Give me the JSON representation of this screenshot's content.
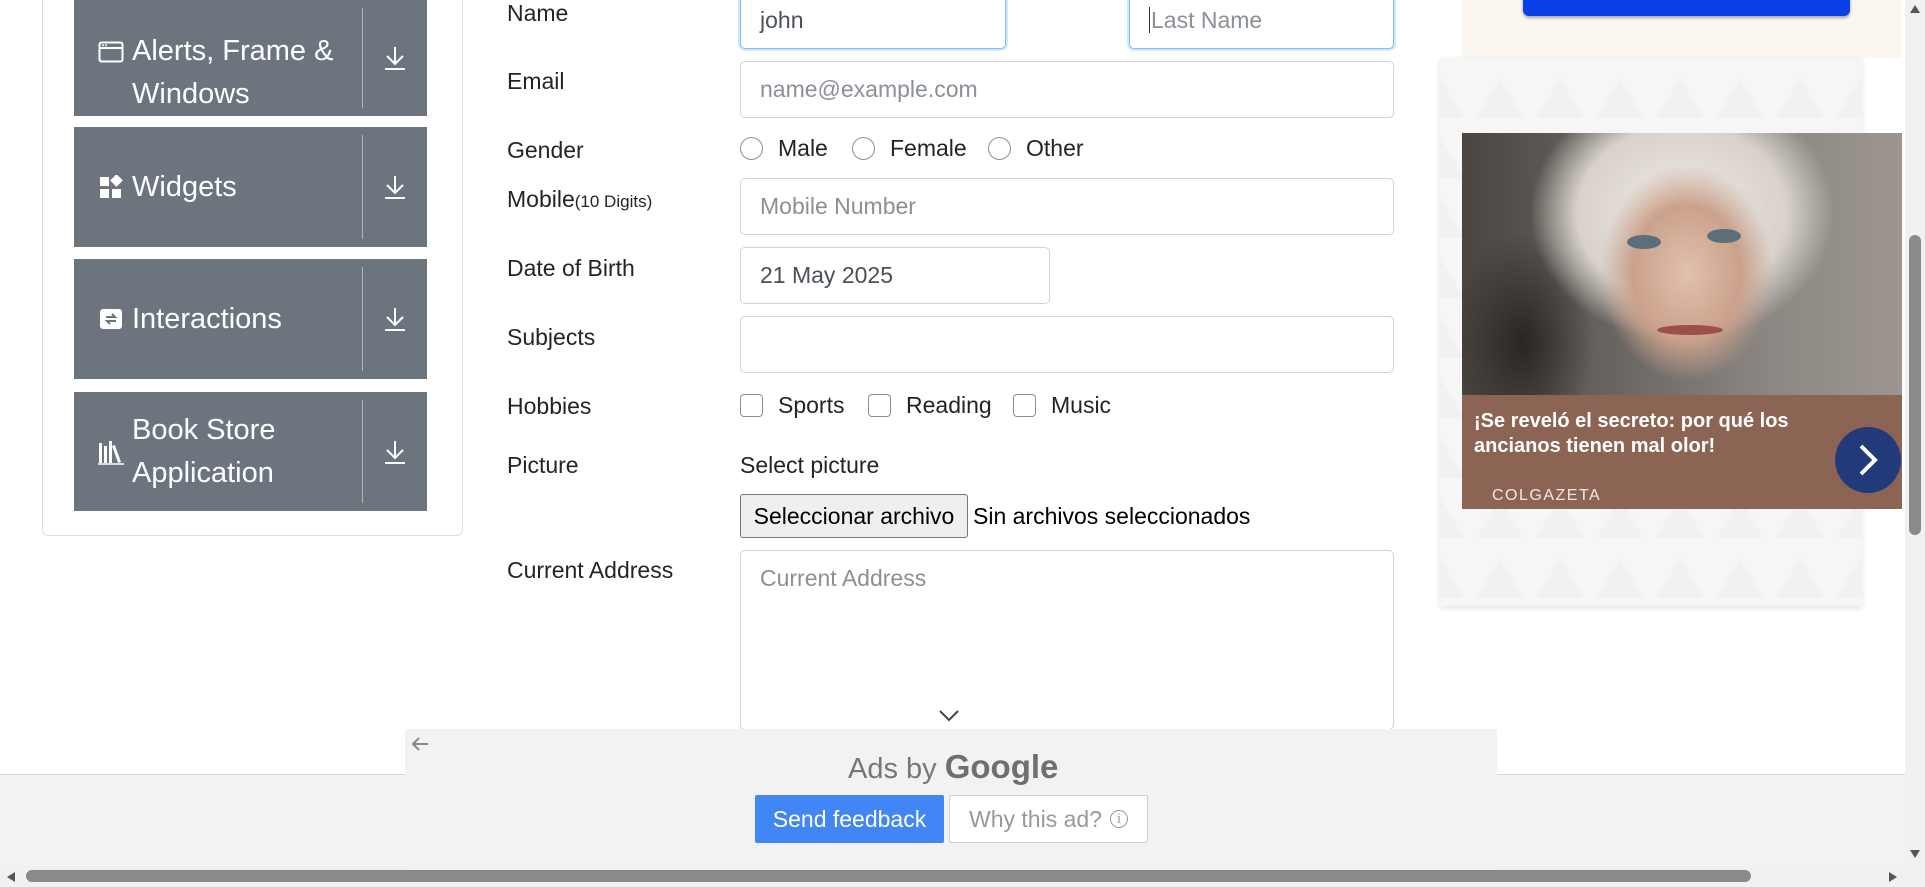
{
  "sidebar": {
    "groups": [
      {
        "label_lines": [
          "Alerts, Frame &",
          "Windows"
        ],
        "icon": "window-icon"
      },
      {
        "label_lines": [
          "Widgets"
        ],
        "icon": "widgets-icon"
      },
      {
        "label_lines": [
          "Interactions"
        ],
        "icon": "interactions-icon"
      },
      {
        "label_lines": [
          "Book Store",
          "Application"
        ],
        "icon": "books-icon"
      }
    ]
  },
  "form": {
    "name_label": "Name",
    "first_name_value": "john",
    "last_name_placeholder": "Last Name",
    "email_label": "Email",
    "email_placeholder": "name@example.com",
    "gender_label": "Gender",
    "gender_options": [
      "Male",
      "Female",
      "Other"
    ],
    "mobile_label": "Mobile",
    "mobile_hint": "(10 Digits)",
    "mobile_placeholder": "Mobile Number",
    "dob_label": "Date of Birth",
    "dob_value": "21 May 2025",
    "subjects_label": "Subjects",
    "subjects_value": "",
    "hobbies_label": "Hobbies",
    "hobby_options": [
      "Sports",
      "Reading",
      "Music"
    ],
    "picture_label": "Picture",
    "select_picture_text": "Select picture",
    "file_button_label": "Seleccionar archivo",
    "file_status": "Sin archivos seleccionados",
    "address_label": "Current Address",
    "address_placeholder": "Current Address"
  },
  "side_ad": {
    "caption": "¡Se reveló el secreto: por qué los ancianos tienen mal olor!",
    "source": "COLGAZETA",
    "next_icon": "chevron-right-icon"
  },
  "bottom_ad": {
    "ads_by": "Ads by",
    "google": "Google",
    "send_feedback": "Send feedback",
    "why_this_ad": "Why this ad?",
    "info_glyph": "i"
  },
  "colors": {
    "sidebar_header": "#6c757d",
    "focus_border": "#80bdff",
    "feedback_button": "#4285f4",
    "ad_caption_bg": "#8c6454",
    "ad_next_button": "#233a7a",
    "ad_top_button": "#0b3fe8"
  }
}
